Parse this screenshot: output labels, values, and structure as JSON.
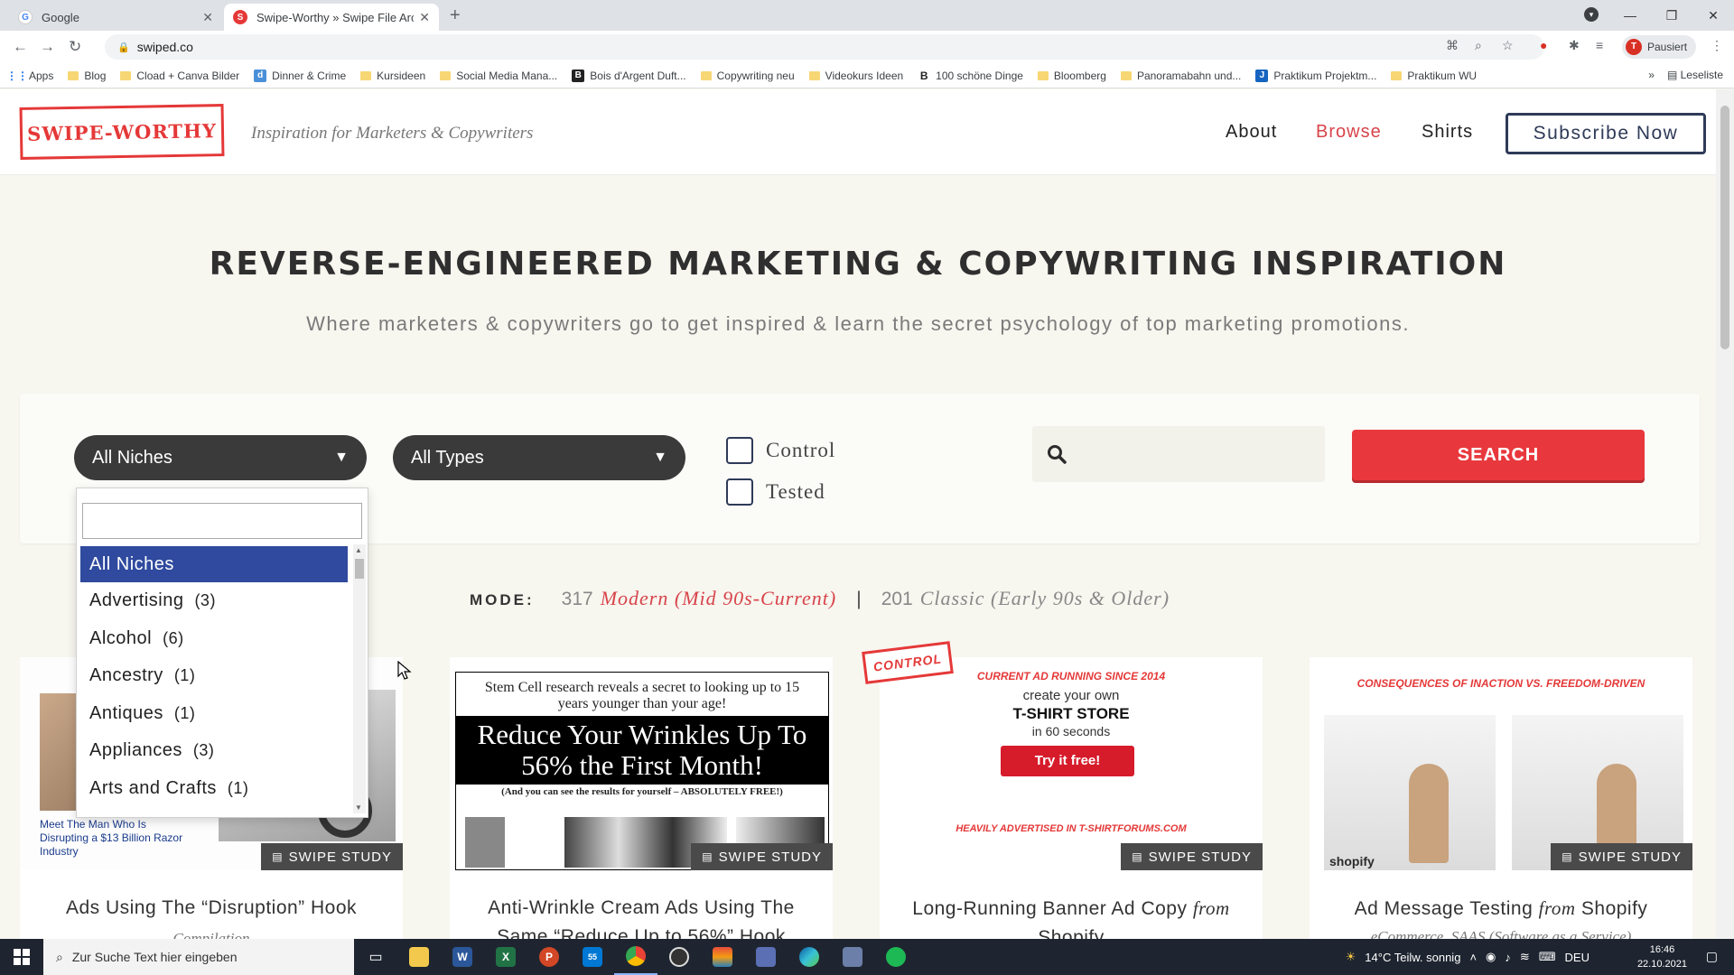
{
  "browser": {
    "tabs": [
      {
        "title": "Google",
        "active": false
      },
      {
        "title": "Swipe-Worthy » Swipe File Archi",
        "active": true
      }
    ],
    "url": "swiped.co",
    "profile_initial": "T",
    "profile_status": "Pausiert",
    "bookmarks": [
      "Apps",
      "Blog",
      "Cload + Canva Bilder",
      "Dinner & Crime",
      "Kursideen",
      "Social Media Mana...",
      "Bois d'Argent Duft...",
      "Copywriting neu",
      "Videokurs Ideen",
      "100 schöne Dinge",
      "Bloomberg",
      "Panoramabahn und...",
      "Praktikum Projektm...",
      "Praktikum WU"
    ],
    "reading_list": "Leseliste"
  },
  "site": {
    "logo_text": "SWIPE-WORTHY",
    "tagline": "Inspiration for Marketers & Copywriters",
    "nav": {
      "about": "About",
      "browse": "Browse",
      "shirts": "Shirts",
      "subscribe": "Subscribe Now"
    },
    "hero_title": "Reverse-Engineered Marketing & Copywriting Inspiration",
    "hero_subtitle": "Where marketers & copywriters go to get inspired & learn the secret psychology of top marketing promotions.",
    "filters": {
      "niche_selected": "All Niches",
      "type_selected": "All Types",
      "control_label": "Control",
      "tested_label": "Tested",
      "search_button": "SEARCH",
      "niche_options": [
        {
          "label": "All Niches",
          "count": ""
        },
        {
          "label": "Advertising",
          "count": "(3)"
        },
        {
          "label": "Alcohol",
          "count": "(6)"
        },
        {
          "label": "Ancestry",
          "count": "(1)"
        },
        {
          "label": "Antiques",
          "count": "(1)"
        },
        {
          "label": "Appliances",
          "count": "(3)"
        },
        {
          "label": "Arts and Crafts",
          "count": "(1)"
        }
      ]
    },
    "mode": {
      "label": "MODE:",
      "modern_count": "317",
      "modern_label": "Modern (Mid 90s-Current)",
      "separator": "|",
      "classic_count": "201",
      "classic_label": "Classic (Early 90s & Older)"
    },
    "cards": [
      {
        "title": "Ads Using The “Disruption” Hook",
        "subtitle": "Compilation",
        "badge": "SWIPE STUDY",
        "thumb_caption": "Meet The Man Who Is Disrupting a $13 Billion Razor Industry"
      },
      {
        "title": "Anti-Wrinkle Cream Ads Using The Same “Reduce Up to 56%” Hook",
        "subtitle": "",
        "badge": "SWIPE STUDY",
        "thumb_top": "Stem Cell research reveals a secret to looking up to 15 years younger than your age!",
        "thumb_headline": "Reduce Your Wrinkles Up To 56% the First Month!",
        "thumb_small": "(And you can see the results for yourself – ABSOLUTELY FREE!)"
      },
      {
        "title": "Long-Running Banner Ad Copy",
        "title_from": "from",
        "title_brand": "Shopify",
        "badge": "SWIPE STUDY",
        "stamp": "CONTROL",
        "thumb_top": "CURRENT AD RUNNING SINCE 2014",
        "thumb_line1": "create your own",
        "thumb_line2": "T-SHIRT STORE",
        "thumb_line3": "in 60 seconds",
        "thumb_button": "Try it free!",
        "thumb_bottom": "HEAVILY ADVERTISED IN T-SHIRTFORUMS.COM"
      },
      {
        "title": "Ad Message Testing",
        "title_from": "from",
        "title_brand": "Shopify",
        "subtitle": "eCommerce, SAAS (Software as a Service)",
        "badge": "SWIPE STUDY",
        "thumb_top": "CONSEQUENCES OF INACTION VS. FREEDOM-DRIVEN",
        "thumb_brand": "shopify"
      }
    ]
  },
  "taskbar": {
    "search_placeholder": "Zur Suche Text hier eingeben",
    "mail_badge": "55",
    "weather": "14°C  Teilw. sonnig",
    "lang": "DEU",
    "time": "16:46",
    "date": "22.10.2021"
  },
  "colors": {
    "accent_red": "#e8383d",
    "navy": "#2e3a58",
    "dropdown_selected": "#2f4a9e"
  }
}
